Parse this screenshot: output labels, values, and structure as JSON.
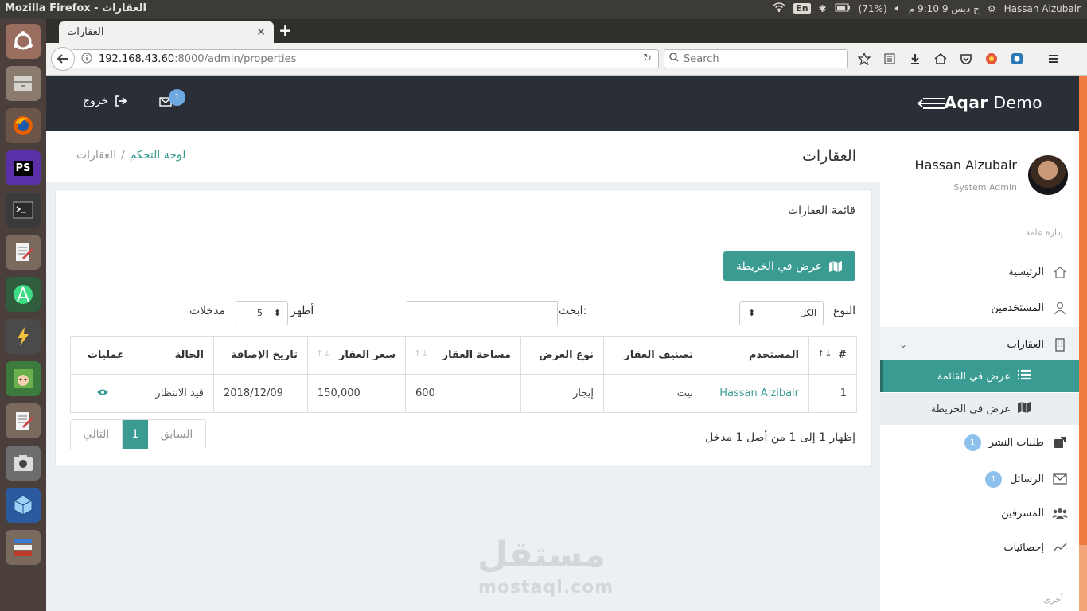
{
  "os": {
    "window_title": "Mozilla Firefox - العقارات",
    "lang": "En",
    "battery": "(71%)",
    "clock": "ح ديس  9  9:10 م",
    "user": "Hassan Alzubair"
  },
  "browser": {
    "tab_title": "العقارات",
    "url_host": "192.168.43.60",
    "url_rest": ":8000/admin/properties",
    "search_placeholder": "Search"
  },
  "header": {
    "brand_bold": "Aqar",
    "brand_rest": " Demo",
    "logout": "خروج",
    "mail_badge": "1"
  },
  "sidebar": {
    "user_name": "Hassan Alzubair",
    "user_role": "System Admin",
    "section_general": "إدارة عامة",
    "items": [
      {
        "label": "الرئيسية"
      },
      {
        "label": "المستخدمين"
      },
      {
        "label": "العقارات"
      },
      {
        "label": "طلبات النشر",
        "badge": "1"
      },
      {
        "label": "الرسائل",
        "badge": "1"
      },
      {
        "label": "المشرفين"
      },
      {
        "label": "إحصائيات"
      }
    ],
    "sub_items": [
      {
        "label": "عرض في القائمة"
      },
      {
        "label": "عرض في الخريطة"
      }
    ],
    "section_other": "أخرى"
  },
  "page": {
    "title": "العقارات",
    "breadcrumb_home": "لوحة التحكم",
    "breadcrumb_sep": "/",
    "breadcrumb_current": "العقارات"
  },
  "card": {
    "title": "قائمة العقارات",
    "map_button": "عرض في الخريطة",
    "type_label": "النوع",
    "type_value": "الكل",
    "search_label": "ابحث:",
    "show_label": "أظهر",
    "show_value": "5",
    "entries_label": "مدخلات",
    "columns": [
      "#",
      "المستخدم",
      "تصنيف العقار",
      "نوع العرض",
      "مساحة العقار",
      "سعر العقار",
      "تاريخ الإضافة",
      "الحالة",
      "عمليات"
    ],
    "rows": [
      {
        "num": "1",
        "user": "Hassan Alzibair",
        "category": "بيت",
        "offer": "إيجار",
        "area": "600",
        "price": "150,000",
        "date": "2018/12/09",
        "status": "قيد الانتظار"
      }
    ],
    "info": "إظهار 1 إلى 1 من أصل 1 مدخل",
    "pager": {
      "prev": "السابق",
      "current": "1",
      "next": "التالي"
    }
  },
  "watermark": {
    "ar": "مستقل",
    "en": "mostaql.com"
  }
}
